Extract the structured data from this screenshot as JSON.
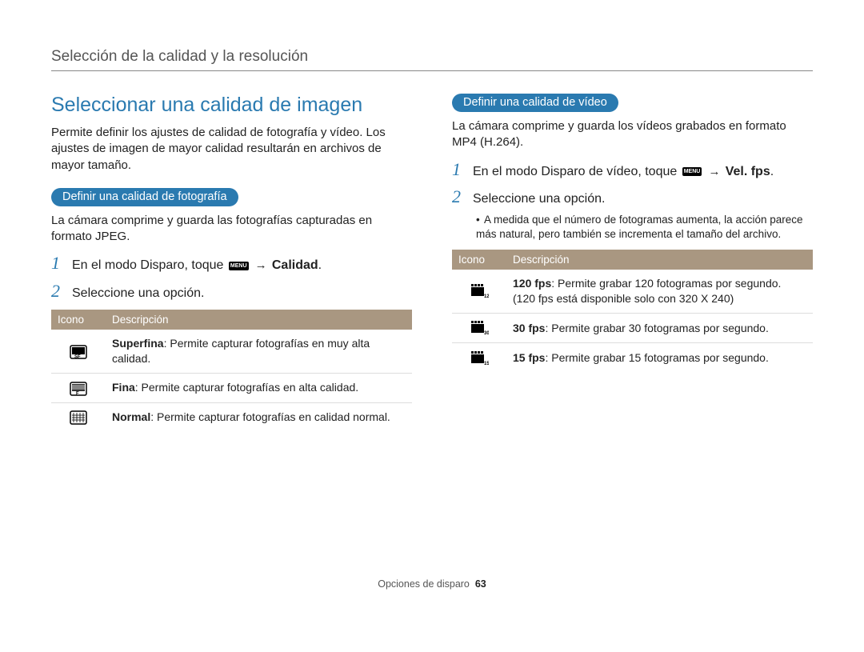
{
  "page_header": "Selección de la calidad y la resolución",
  "section_title": "Seleccionar una calidad de imagen",
  "intro_para": "Permite definir los ajustes de calidad de fotografía y vídeo. Los ajustes de imagen de mayor calidad resultarán en archivos de mayor tamaño.",
  "left": {
    "pill": "Definir una calidad de fotografía",
    "para": "La cámara comprime y guarda las fotografías capturadas en formato JPEG.",
    "step1_pre": "En el modo Disparo, toque ",
    "step1_menu": "MENU",
    "step1_arrow": " → ",
    "step1_bold": "Calidad",
    "step1_dot": ".",
    "step2": "Seleccione una opción.",
    "table": {
      "head_icon": "Icono",
      "head_desc": "Descripción",
      "rows": [
        {
          "icon_name": "superfine-icon",
          "bold": "Superfina",
          "text": ": Permite capturar fotografías en muy alta calidad."
        },
        {
          "icon_name": "fine-icon",
          "bold": "Fina",
          "text": ": Permite capturar fotografías en alta calidad."
        },
        {
          "icon_name": "normal-icon",
          "bold": "Normal",
          "text": ": Permite capturar fotografías en calidad normal."
        }
      ]
    }
  },
  "right": {
    "pill": "Definir una calidad de vídeo",
    "para": "La cámara comprime y guarda los vídeos grabados en formato MP4 (H.264).",
    "step1_pre": "En el modo Disparo de vídeo, toque ",
    "step1_menu": "MENU",
    "step1_arrow": " → ",
    "step1_bold": "Vel. fps",
    "step1_dot": ".",
    "step2": "Seleccione una opción.",
    "bullet": "A medida que el número de fotogramas aumenta, la acción parece más natural, pero también se incrementa el tamaño del archivo.",
    "table": {
      "head_icon": "Icono",
      "head_desc": "Descripción",
      "rows": [
        {
          "icon_name": "fps120-icon",
          "label": "120",
          "bold": "120 fps",
          "text": ": Permite grabar 120 fotogramas por segundo. (120 fps está disponible solo con 320 X 240)"
        },
        {
          "icon_name": "fps30-icon",
          "label": "30",
          "bold": "30 fps",
          "text": ": Permite grabar 30 fotogramas por segundo."
        },
        {
          "icon_name": "fps15-icon",
          "label": "15",
          "bold": "15 fps",
          "text": ": Permite grabar 15 fotogramas por segundo."
        }
      ]
    }
  },
  "footer": {
    "section": "Opciones de disparo",
    "page": "63"
  }
}
